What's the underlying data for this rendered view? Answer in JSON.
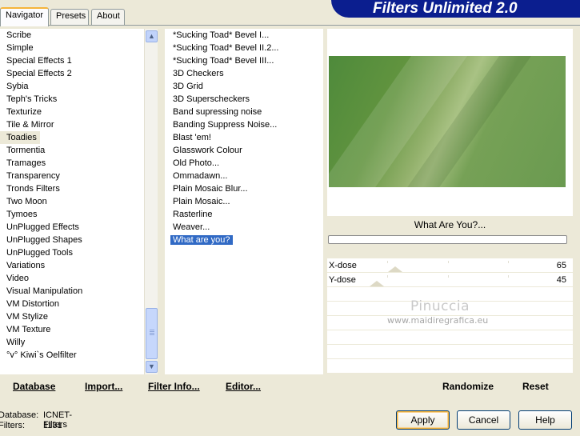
{
  "banner": {
    "title": "Filters Unlimited 2.0"
  },
  "tabs": [
    {
      "label": "Navigator",
      "active": true
    },
    {
      "label": "Presets",
      "active": false
    },
    {
      "label": "About",
      "active": false
    }
  ],
  "categories": [
    "Scribe",
    "Simple",
    "Special Effects 1",
    "Special Effects 2",
    "Sybia",
    "Teph's Tricks",
    "Texturize",
    "Tile & Mirror",
    "Toadies",
    "Tormentia",
    "Tramages",
    "Transparency",
    "Tronds Filters",
    "Two Moon",
    "Tymoes",
    "UnPlugged Effects",
    "UnPlugged Shapes",
    "UnPlugged Tools",
    "Variations",
    "Video",
    "Visual Manipulation",
    "VM Distortion",
    "VM Stylize",
    "VM Texture",
    "Willy",
    "°v° Kiwi`s Oelfilter"
  ],
  "selected_category": "Toadies",
  "filters": [
    "*Sucking Toad*  Bevel I...",
    "*Sucking Toad*  Bevel II.2...",
    "*Sucking Toad*  Bevel III...",
    "3D Checkers",
    "3D Grid",
    "3D Superscheckers",
    "Band supressing noise",
    "Banding Suppress Noise...",
    "Blast 'em!",
    "Glasswork Colour",
    "Old Photo...",
    "Ommadawn...",
    "Plain Mosaic Blur...",
    "Plain Mosaic...",
    "Rasterline",
    "Weaver...",
    "What are you?"
  ],
  "selected_filter": "What are you?",
  "preview": {
    "filter_name": "What Are You?...",
    "progress": 0
  },
  "params": [
    {
      "label": "X-dose",
      "value": "65",
      "level": 65
    },
    {
      "label": "Y-dose",
      "value": "45",
      "level": 45
    }
  ],
  "watermark": {
    "line1": "Pinuccia",
    "line2": "www.maidiregrafica.eu"
  },
  "toolbar": {
    "database": "Database",
    "import": "Import...",
    "filter_info": "Filter Info...",
    "editor": "Editor...",
    "randomize": "Randomize",
    "reset": "Reset"
  },
  "status": {
    "database_label": "Database:",
    "database_value": "ICNET-Filters",
    "filters_label": "Filters:",
    "filters_value": "1131"
  },
  "buttons": {
    "apply": "Apply",
    "cancel": "Cancel",
    "help": "Help"
  },
  "icons": {
    "scroll_up": "chevron-up-icon",
    "scroll_down": "chevron-down-icon"
  }
}
